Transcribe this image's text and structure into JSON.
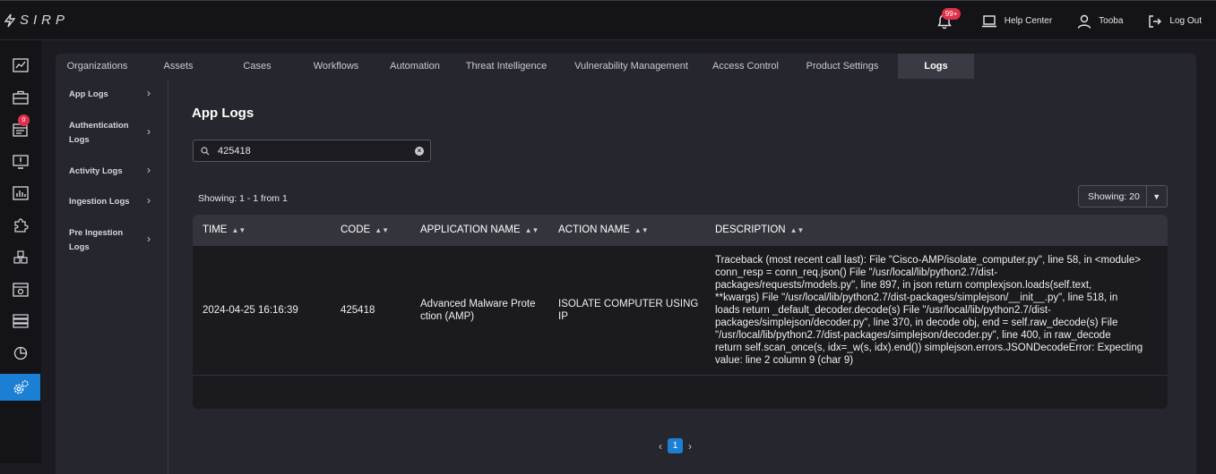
{
  "app": {
    "logo_text": "SIRP"
  },
  "header": {
    "notification_count": "99+",
    "help_center": "Help Center",
    "user_name": "Tooba",
    "logout": "Log Out"
  },
  "sidebar": {
    "icons": [
      "dashboard-icon",
      "briefcase-icon",
      "calendar-icon",
      "alert-monitor-icon",
      "bar-chart-icon",
      "puzzle-icon",
      "cubes-icon",
      "report-icon",
      "server-icon",
      "pie-chart-icon",
      "settings-gear-icon"
    ],
    "calendar_badge": "0"
  },
  "tabs": [
    "Organizations",
    "Assets",
    "Cases",
    "Workflows",
    "Automation",
    "Threat Intelligence",
    "Vulnerability Management",
    "Access Control",
    "Product Settings",
    "Logs"
  ],
  "active_tab": "Logs",
  "subnav": [
    {
      "line1": "App Logs",
      "line2": ""
    },
    {
      "line1": "Authentication",
      "line2": "Logs"
    },
    {
      "line1": "Activity Logs",
      "line2": ""
    },
    {
      "line1": "Ingestion Logs",
      "line2": ""
    },
    {
      "line1": "Pre Ingestion",
      "line2": "Logs"
    }
  ],
  "page": {
    "title": "App Logs",
    "search_value": "425418",
    "showing_text": "Showing: 1 - 1 from 1",
    "page_size_label": "Showing: 20"
  },
  "table": {
    "columns": [
      "TIME",
      "CODE",
      "APPLICATION NAME",
      "ACTION NAME",
      "DESCRIPTION"
    ],
    "rows": [
      {
        "time": "2024-04-25 16:16:39",
        "code": "425418",
        "app_line1": "Advanced Malware Prote",
        "app_line2": "ction (AMP)",
        "action_line1": "ISOLATE COMPUTER USING",
        "action_line2": "IP",
        "desc_lines": [
          "Traceback (most recent call last): File \"Cisco-AMP/isolate_computer.py\", line 58, in <module>",
          "conn_resp = conn_req.json() File \"/usr/local/lib/python2.7/dist-",
          "packages/requests/models.py\", line 897, in json return complexjson.loads(self.text,",
          "**kwargs) File \"/usr/local/lib/python2.7/dist-packages/simplejson/__init__.py\", line 518, in",
          "loads return _default_decoder.decode(s) File \"/usr/local/lib/python2.7/dist-",
          "packages/simplejson/decoder.py\", line 370, in decode obj, end = self.raw_decode(s) File",
          "\"/usr/local/lib/python2.7/dist-packages/simplejson/decoder.py\", line 400, in raw_decode",
          "return self.scan_once(s, idx=_w(s, idx).end()) simplejson.errors.JSONDecodeError: Expecting",
          "value: line 2 column 9 (char 9)"
        ]
      }
    ]
  },
  "pagination": {
    "prev": "‹",
    "current": "1",
    "next": "›"
  }
}
